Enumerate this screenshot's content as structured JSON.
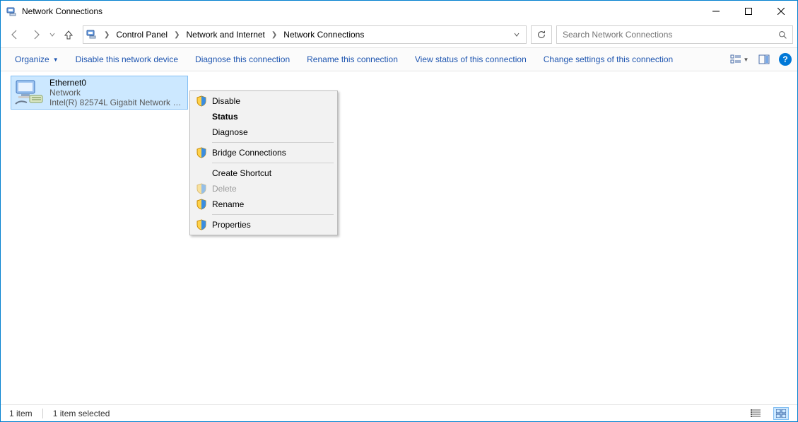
{
  "window": {
    "title": "Network Connections"
  },
  "breadcrumbs": {
    "items": [
      "Control Panel",
      "Network and Internet",
      "Network Connections"
    ]
  },
  "search": {
    "placeholder": "Search Network Connections"
  },
  "commands": {
    "organize": "Organize",
    "disable": "Disable this network device",
    "diagnose": "Diagnose this connection",
    "rename": "Rename this connection",
    "viewstatus": "View status of this connection",
    "changesettings": "Change settings of this connection"
  },
  "adapter": {
    "name": "Ethernet0",
    "network": "Network",
    "device": "Intel(R) 82574L Gigabit Network C..."
  },
  "contextmenu": {
    "disable": "Disable",
    "status": "Status",
    "diagnose": "Diagnose",
    "bridge": "Bridge Connections",
    "shortcut": "Create Shortcut",
    "delete": "Delete",
    "rename": "Rename",
    "properties": "Properties"
  },
  "status": {
    "count": "1 item",
    "selected": "1 item selected"
  }
}
